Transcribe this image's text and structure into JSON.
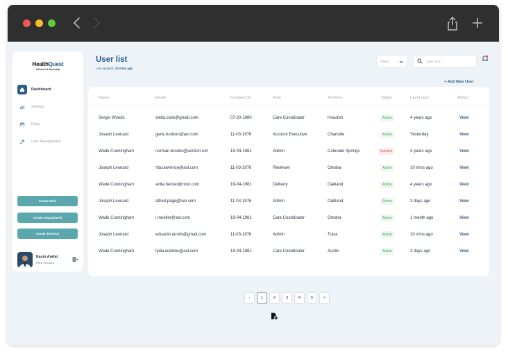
{
  "brand": {
    "name_part1": "Health",
    "name_part2": "Quest",
    "tagline": "Infusion & Specialty"
  },
  "sidebar": {
    "items": [
      {
        "label": "Dashboard",
        "icon": "home-icon"
      },
      {
        "label": "Settings",
        "icon": "bar-chart-icon"
      },
      {
        "label": "Extra",
        "icon": "image-icon"
      },
      {
        "label": "User Management",
        "icon": "wrench-icon"
      }
    ],
    "buttons": [
      "Create Role",
      "Create Department",
      "Create Territory"
    ],
    "profile": {
      "name": "Easin Arafat",
      "plan": "Free Account"
    }
  },
  "header": {
    "title": "User list",
    "last_updated_label": "Last updated:",
    "last_updated_value": "10 mins ago",
    "filter_label": "Filters",
    "search_placeholder": "Type here...",
    "add_user_label": "+ Add New User"
  },
  "table": {
    "columns": [
      "Name",
      "Email",
      "Created On",
      "Role",
      "Territory",
      "Status",
      "Last Login",
      "Action"
    ],
    "action_label": "View",
    "rows": [
      {
        "name": "Sergio Woods",
        "email": "stella.clark@gmail.com",
        "created": "07-20-1980",
        "role": "Care Coordinator",
        "territory": "Houston",
        "status": "Active",
        "last_login": "4 years ago"
      },
      {
        "name": "Joseph Leonard",
        "email": "gene.hudson@aol.com",
        "created": "11-03-1976",
        "role": "Account Executive",
        "territory": "Charlotte",
        "status": "Active",
        "last_login": "Yesterday"
      },
      {
        "name": "Wade Cunningham",
        "email": "norman.brooks@verizon.net",
        "created": "19-04-1981",
        "role": "Admin",
        "territory": "Colorado Springs",
        "status": "Inactive",
        "last_login": "4 years ago"
      },
      {
        "name": "Joseph Leonard",
        "email": "rita.lawrence@aol.com",
        "created": "11-03-1976",
        "role": "Reviewer",
        "territory": "Omaha",
        "status": "Active",
        "last_login": "10 mins ago"
      },
      {
        "name": "Wade Cunningham",
        "email": "anita.becker@msn.com",
        "created": "19-04-1981",
        "role": "Delivery",
        "territory": "Oakland",
        "status": "Active",
        "last_login": "4 years ago"
      },
      {
        "name": "Joseph Leonard",
        "email": "alfred.page@live.com",
        "created": "11-03-1976",
        "role": "Admin",
        "territory": "Oakland",
        "status": "Active",
        "last_login": "3 days ago"
      },
      {
        "name": "Wade Cunningham",
        "email": "l.mueller@aol.com",
        "created": "19-04-1981",
        "role": "Care Coordinator",
        "territory": "Omaha",
        "status": "Active",
        "last_login": "1 month ago"
      },
      {
        "name": "Joseph Leonard",
        "email": "eduardo.austin@gmail.com",
        "created": "11-03-1976",
        "role": "Admin",
        "territory": "Tulsa",
        "status": "Active",
        "last_login": "10 mins ago"
      },
      {
        "name": "Wade Cunningham",
        "email": "lydia.watkins@aol.com",
        "created": "19-04-1981",
        "role": "Care Coordinator",
        "territory": "Austin",
        "status": "Active",
        "last_login": "3 days ago"
      }
    ]
  },
  "pagination": {
    "prev": "<",
    "pages": [
      "1",
      "2",
      "3",
      "4",
      "5"
    ],
    "next": ">",
    "current": "1"
  },
  "colors": {
    "accent": "#2b5d8a",
    "button": "#5aa7ad",
    "active": "#38a651",
    "inactive": "#d9534f"
  }
}
